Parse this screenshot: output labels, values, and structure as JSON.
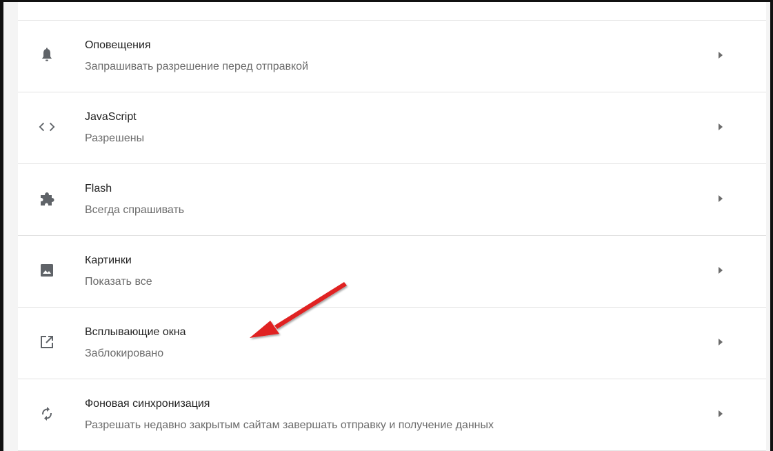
{
  "settings_list": {
    "rows": [
      {
        "title": "Оповещения",
        "subtitle": "Запрашивать разрешение перед отправкой",
        "icon": "bell-icon"
      },
      {
        "title": "JavaScript",
        "subtitle": "Разрешены",
        "icon": "code-icon"
      },
      {
        "title": "Flash",
        "subtitle": "Всегда спрашивать",
        "icon": "puzzle-icon"
      },
      {
        "title": "Картинки",
        "subtitle": "Показать все",
        "icon": "image-icon"
      },
      {
        "title": "Всплывающие окна",
        "subtitle": "Заблокировано",
        "icon": "open-in-new-icon"
      },
      {
        "title": "Фоновая синхронизация",
        "subtitle": "Разрешать недавно закрытым сайтам завершать отправку и получение данных",
        "icon": "sync-icon"
      }
    ]
  },
  "annotation": {
    "arrow_color": "#e02020",
    "points_to": "Всплывающие окна"
  },
  "colors": {
    "icon": "#5f6368",
    "title_text": "#222222",
    "subtitle_text": "#6b6b6b",
    "divider": "#e2e2e2",
    "frame": "#111111"
  }
}
